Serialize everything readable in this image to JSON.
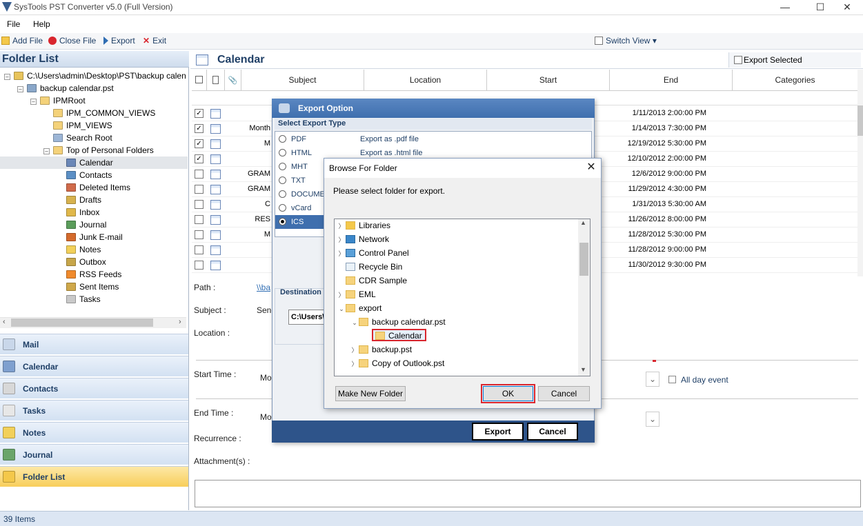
{
  "window": {
    "title": "SysTools PST Converter v5.0 (Full Version)"
  },
  "menu": [
    "File",
    "Help"
  ],
  "toolbar": {
    "add_file": "Add File",
    "close_file": "Close File",
    "export": "Export",
    "exit": "Exit",
    "switch_view": "Switch View"
  },
  "folder_list": {
    "title": "Folder List",
    "items": [
      {
        "label": "C:\\Users\\admin\\Desktop\\PST\\backup calen",
        "level": 0,
        "exp": "-"
      },
      {
        "label": "backup calendar.pst",
        "level": 1,
        "exp": "-"
      },
      {
        "label": "IPMRoot",
        "level": 2,
        "exp": "-"
      },
      {
        "label": "IPM_COMMON_VIEWS",
        "level": 3,
        "exp": ""
      },
      {
        "label": "IPM_VIEWS",
        "level": 3,
        "exp": ""
      },
      {
        "label": "Search Root",
        "level": 3,
        "exp": ""
      },
      {
        "label": "Top of Personal Folders",
        "level": 3,
        "exp": "-"
      },
      {
        "label": "Calendar",
        "level": 4,
        "exp": ""
      },
      {
        "label": "Contacts",
        "level": 4,
        "exp": ""
      },
      {
        "label": "Deleted Items",
        "level": 4,
        "exp": ""
      },
      {
        "label": "Drafts",
        "level": 4,
        "exp": ""
      },
      {
        "label": "Inbox",
        "level": 4,
        "exp": ""
      },
      {
        "label": "Journal",
        "level": 4,
        "exp": ""
      },
      {
        "label": "Junk E-mail",
        "level": 4,
        "exp": ""
      },
      {
        "label": "Notes",
        "level": 4,
        "exp": ""
      },
      {
        "label": "Outbox",
        "level": 4,
        "exp": ""
      },
      {
        "label": "RSS Feeds",
        "level": 4,
        "exp": ""
      },
      {
        "label": "Sent Items",
        "level": 4,
        "exp": ""
      },
      {
        "label": "Tasks",
        "level": 4,
        "exp": ""
      }
    ]
  },
  "nav": [
    "Mail",
    "Calendar",
    "Contacts",
    "Tasks",
    "Notes",
    "Journal",
    "Folder List"
  ],
  "status": {
    "items": "39 Items"
  },
  "calendar": {
    "title": "Calendar",
    "export_selected": "Export Selected",
    "columns": [
      "Subject",
      "Location",
      "Start",
      "End",
      "Categories"
    ],
    "rows": [
      {
        "checked": true,
        "subject": "",
        "end": "1/11/2013 2:00:00 PM"
      },
      {
        "checked": true,
        "subject": "Month",
        "end": "1/14/2013 7:30:00 PM"
      },
      {
        "checked": true,
        "subject": "M",
        "end": "12/19/2012 5:30:00 PM"
      },
      {
        "checked": true,
        "subject": "",
        "end": "12/10/2012 2:00:00 PM"
      },
      {
        "checked": false,
        "subject": "GRAM",
        "end": "12/6/2012 9:00:00 PM"
      },
      {
        "checked": false,
        "subject": "GRAM",
        "end": "11/29/2012 4:30:00 PM"
      },
      {
        "checked": false,
        "subject": "C",
        "end": "1/31/2013 5:30:00 AM"
      },
      {
        "checked": false,
        "subject": "RES",
        "end": "11/26/2012 8:00:00 PM"
      },
      {
        "checked": false,
        "subject": "M",
        "end": "11/28/2012 5:30:00 PM"
      },
      {
        "checked": false,
        "subject": "",
        "end": "11/28/2012 9:00:00 PM"
      },
      {
        "checked": false,
        "subject": "",
        "end": "11/30/2012 9:30:00 PM"
      }
    ]
  },
  "detail": {
    "path_label": "Path :",
    "path_value": "\\\\ba",
    "subject_label": "Subject :",
    "subject_value": "Senc",
    "location_label": "Location :",
    "start_label": "Start Time :",
    "start_value": "Mo",
    "end_label": "End Time :",
    "end_value": "Mo",
    "recurrence_label": "Recurrence :",
    "attachments_label": "Attachment(s) :",
    "all_day": "All day event"
  },
  "export_dialog": {
    "title": "Export Option",
    "type_header": "Select Export Type",
    "options": [
      {
        "name": "PDF",
        "desc": "Export as .pdf file",
        "selected": false
      },
      {
        "name": "HTML",
        "desc": "Export as .html file",
        "selected": false
      },
      {
        "name": "MHT",
        "desc": "",
        "selected": false
      },
      {
        "name": "TXT",
        "desc": "",
        "selected": false
      },
      {
        "name": "DOCUME",
        "desc": "",
        "selected": false
      },
      {
        "name": "vCard",
        "desc": "",
        "selected": false
      },
      {
        "name": "ICS",
        "desc": "",
        "selected": true
      }
    ],
    "destination_label": "Destination",
    "destination_value": "C:\\Users\\",
    "export_btn": "Export",
    "cancel_btn": "Cancel"
  },
  "browse_dialog": {
    "title": "Browse For Folder",
    "prompt": "Please select folder for export.",
    "tree": [
      {
        "label": "Libraries",
        "level": 0,
        "caret": ">"
      },
      {
        "label": "Network",
        "level": 0,
        "caret": ">"
      },
      {
        "label": "Control Panel",
        "level": 0,
        "caret": ">"
      },
      {
        "label": "Recycle Bin",
        "level": 0,
        "caret": ""
      },
      {
        "label": "CDR Sample",
        "level": 0,
        "caret": ""
      },
      {
        "label": "EML",
        "level": 0,
        "caret": ">"
      },
      {
        "label": "export",
        "level": 0,
        "caret": "v"
      },
      {
        "label": "backup calendar.pst",
        "level": 1,
        "caret": "v"
      },
      {
        "label": "Calendar",
        "level": 2,
        "caret": "",
        "selected": true
      },
      {
        "label": "backup.pst",
        "level": 1,
        "caret": ">"
      },
      {
        "label": "Copy of Outlook.pst",
        "level": 1,
        "caret": ">"
      }
    ],
    "make_new_folder": "Make New Folder",
    "ok": "OK",
    "cancel": "Cancel"
  },
  "colors": {
    "accent": "#1f3f66",
    "header_blue": "#3f6fae",
    "highlight_red": "#d9262e",
    "nav_active": "#f8ce5a"
  }
}
